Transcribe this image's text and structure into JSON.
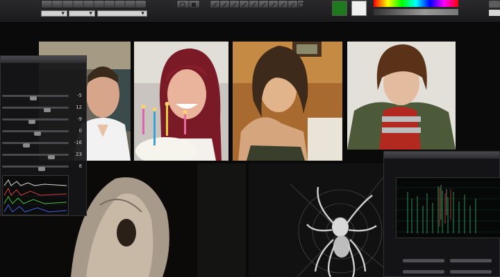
{
  "toolbar": {
    "icons": [
      "grid-icon",
      "pencil-icon",
      "brush-icon",
      "eyedropper-icon",
      "lasso-icon",
      "crop-icon",
      "wand-icon",
      "eraser-icon",
      "stamp-icon",
      "gradient-icon"
    ],
    "colors": {
      "foreground": "#1f7a1f",
      "background": "#efefef"
    }
  },
  "gallery": {
    "photos": [
      {
        "subject": "man-in-white-shirt"
      },
      {
        "subject": "woman-with-birthday-cake"
      },
      {
        "subject": "girl-with-bangs-looking-back"
      },
      {
        "subject": "boy-in-red-shirt"
      },
      {
        "subject": "hooded-figure"
      },
      {
        "subject": "spider"
      }
    ]
  },
  "settings_panel": {
    "values": [
      "-5",
      "12",
      "-9",
      "0",
      "-16",
      "23",
      "8"
    ]
  },
  "colors": {
    "accent": "#3aa86a",
    "panel": "#161618",
    "background": "#0a0a0b"
  }
}
